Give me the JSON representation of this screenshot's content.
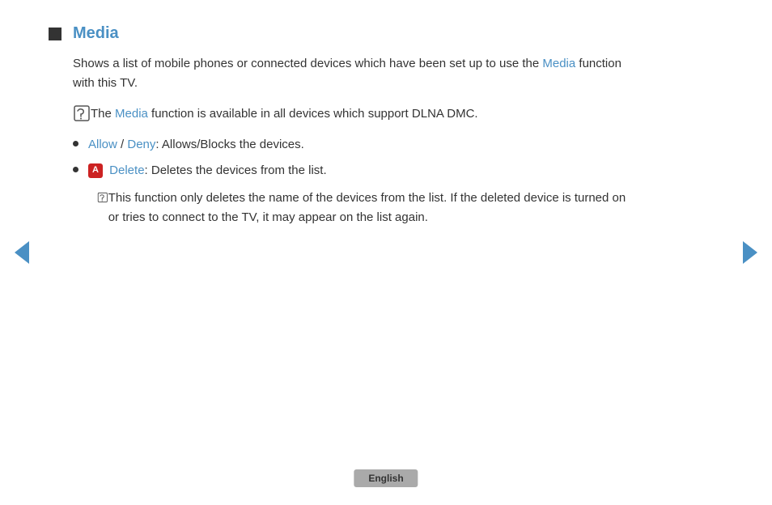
{
  "section": {
    "title": "Media",
    "description": "Shows a list of mobile phones or connected devices which have been set up to use the",
    "description_link": "Media",
    "description_end": "function with this TV.",
    "note1": "The",
    "note1_link": "Media",
    "note1_end": "function is available in all devices which support DLNA DMC.",
    "bullet1_link1": "Allow",
    "bullet1_sep": " / ",
    "bullet1_link2": "Deny",
    "bullet1_end": ": Allows/Blocks the devices.",
    "bullet2_badge": "A",
    "bullet2_link": "Delete",
    "bullet2_end": ": Deletes the devices from the list.",
    "sub_note": "This function only deletes the name of the devices from the list. If the deleted device is turned on or tries to connect to the TV, it may appear on the list again."
  },
  "nav": {
    "left_arrow": "◀",
    "right_arrow": "▶"
  },
  "language": {
    "label": "English"
  }
}
